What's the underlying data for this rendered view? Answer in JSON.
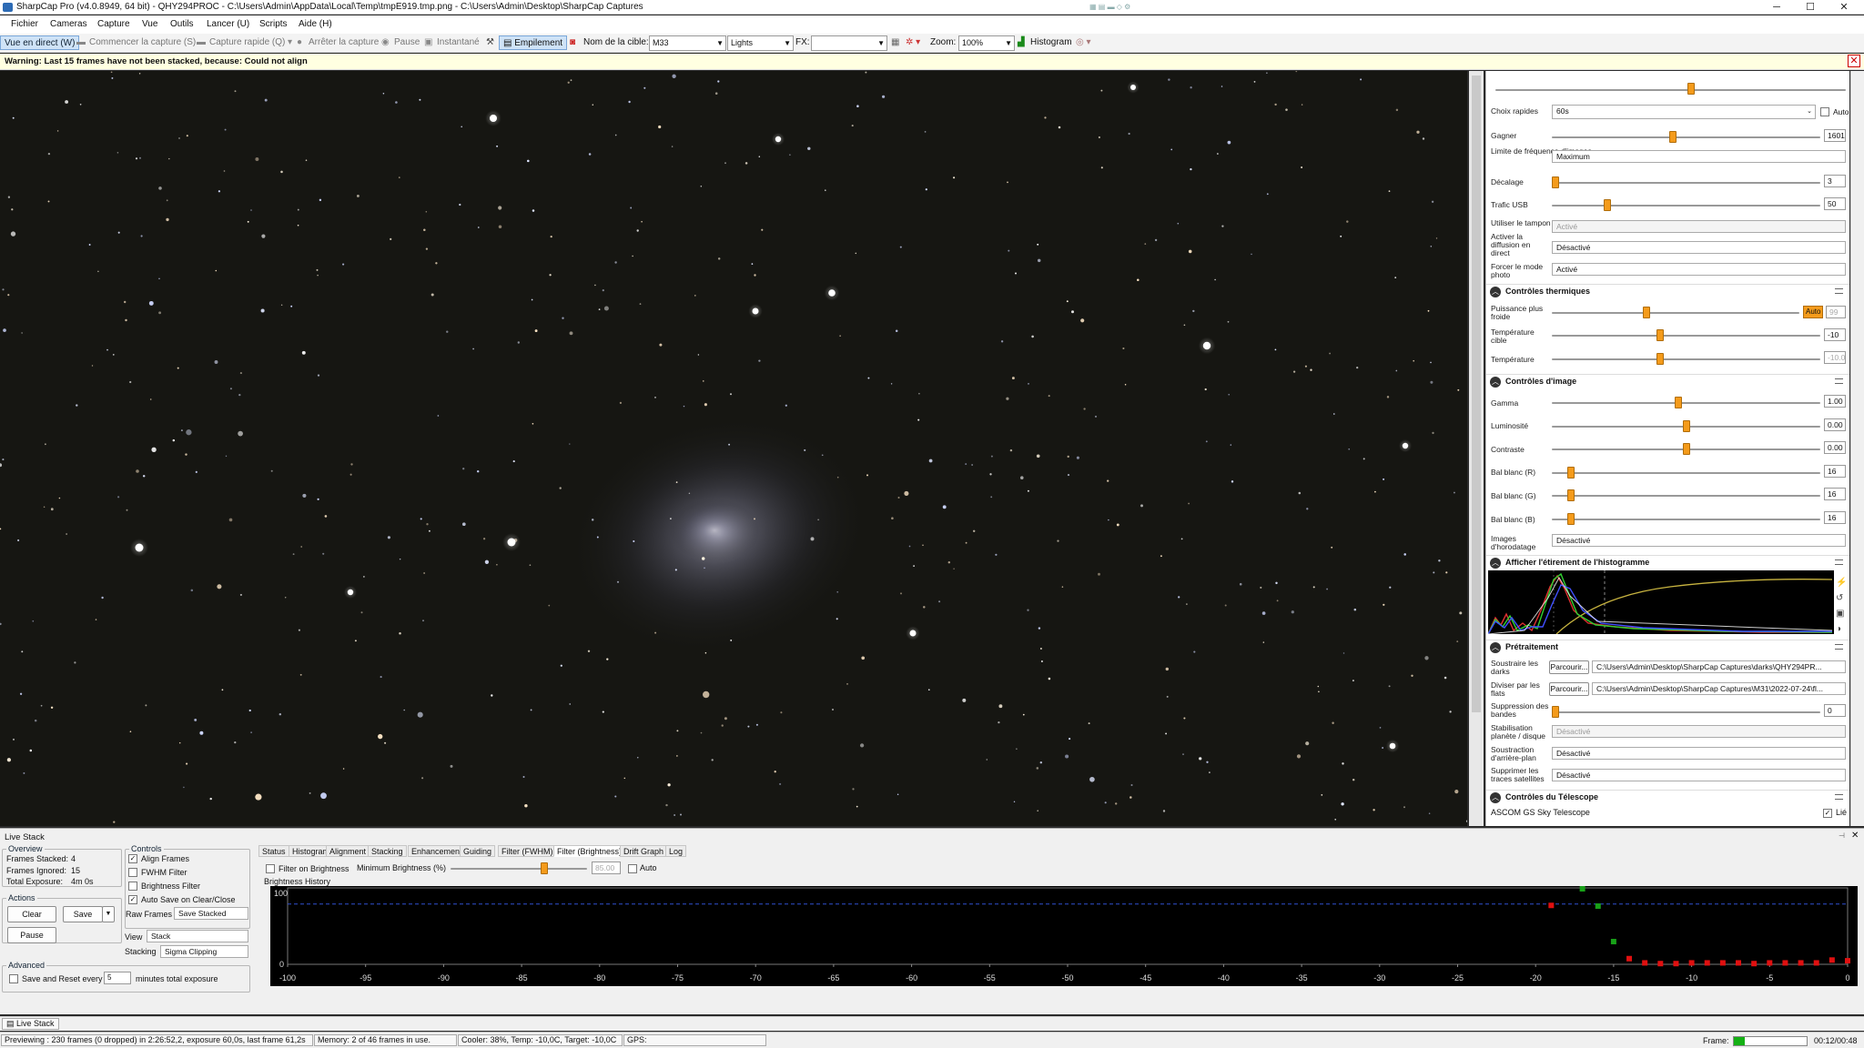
{
  "titlebar": {
    "title": "SharpCap Pro (v4.0.8949, 64 bit) - QHY294PROC - C:\\Users\\Admin\\AppData\\Local\\Temp\\tmpE919.tmp.png - C:\\Users\\Admin\\Desktop\\SharpCap Captures",
    "minimize": "─",
    "maximize": "☐",
    "close": "✕"
  },
  "menubar": [
    "Fichier",
    "Cameras",
    "Capture",
    "Vue",
    "Outils",
    "Lancer (U)",
    "Scripts",
    "Aide (H)"
  ],
  "toolbar": {
    "live_view": "Vue en direct (W)",
    "start_capture": "Commencer la capture (S)",
    "quick_capture": "Capture rapide (Q)",
    "stop_capture": "Arrêter la capture",
    "pause": "Pause",
    "snapshot": "Instantané",
    "stacking": "Empilement",
    "target_label": "Nom de la cible:",
    "target_value": "M33",
    "frame_type": "Lights",
    "fx_label": "FX:",
    "fx_value": "",
    "zoom_label": "Zoom:",
    "zoom_value": "100%",
    "histogram": "Histogram"
  },
  "warning": {
    "text": "Warning: Last 15 frames have not been stacked, because: Could not align",
    "close": "✕"
  },
  "camera_controls": {
    "quick_picks_label": "Choix rapides",
    "quick_picks_value": "60s",
    "auto_label": "Auto",
    "gain_label": "Gagner",
    "gain_value": "1601",
    "gain_level": 0.45,
    "framerate_label": "Limite de fréquence d'images",
    "framerate_value": "Maximum",
    "offset_label": "Décalage",
    "offset_value": "3",
    "offset_level": 0.0,
    "usb_label": "Trafic USB",
    "usb_value": "50",
    "usb_level": 0.2,
    "ddr_label": "Utiliser le tampon DDR",
    "ddr_value": "Activé",
    "stream_label": "Activer la diffusion en direct",
    "stream_value": "Désactivé",
    "photo_label": "Forcer le mode photo",
    "photo_value": "Activé",
    "top_slider_level": 0.56
  },
  "thermal": {
    "title": "Contrôles thermiques",
    "cooler_label": "Puissance plus froide",
    "cooler_auto": "Auto",
    "cooler_value": "99",
    "cooler_level": 0.38,
    "target_label": "Température cible",
    "target_value": "-10",
    "target_level": 0.4,
    "temp_label": "Température",
    "temp_value": "-10.0",
    "temp_level": 0.4
  },
  "image": {
    "title": "Contrôles d'image",
    "gamma_label": "Gamma",
    "gamma_value": "1.00",
    "gamma_level": 0.47,
    "brightness_label": "Luminosité",
    "brightness_value": "0.00",
    "brightness_level": 0.5,
    "contrast_label": "Contraste",
    "contrast_value": "0.00",
    "contrast_level": 0.5,
    "wbr_label": "Bal blanc (R)",
    "wbr_value": "16",
    "wbr_level": 0.06,
    "wbg_label": "Bal blanc (G)",
    "wbg_value": "16",
    "wbg_level": 0.06,
    "wbb_label": "Bal blanc (B)",
    "wbb_value": "16",
    "wbb_level": 0.06,
    "timestamp_label": "Images d'horodatage",
    "timestamp_value": "Désactivé"
  },
  "histogram_stretch": {
    "title": "Afficher l'étirement de l'histogramme"
  },
  "preprocessing": {
    "title": "Prétraitement",
    "darks_label": "Soustraire les darks",
    "darks_browse": "Parcourir...",
    "darks_path": "C:\\Users\\Admin\\Desktop\\SharpCap Captures\\darks\\QHY294PR...",
    "flats_label": "Diviser par les flats",
    "flats_browse": "Parcourir...",
    "flats_path": "C:\\Users\\Admin\\Desktop\\SharpCap Captures\\M31\\2022-07-24\\fl...",
    "banding_label": "Suppression des bandes",
    "banding_value": "0",
    "banding_level": 0.0,
    "stabilize_label": "Stabilisation planète / disque",
    "stabilize_value": "Désactivé",
    "bgsub_label": "Soustraction d'arrière-plan",
    "bgsub_value": "Désactivé",
    "sat_label": "Supprimer les traces satellites",
    "sat_value": "Désactivé"
  },
  "telescope": {
    "title": "Contrôles du Télescope",
    "mount": "ASCOM GS Sky Telescope",
    "link": "Lié"
  },
  "livestack": {
    "title": "Live Stack",
    "overview": {
      "title": "Overview",
      "stacked_label": "Frames Stacked:",
      "stacked": "4",
      "ignored_label": "Frames Ignored:",
      "ignored": "15",
      "exposure_label": "Total Exposure:",
      "exposure": "4m 0s"
    },
    "actions": {
      "title": "Actions",
      "clear": "Clear",
      "save": "Save",
      "pause": "Pause"
    },
    "controls": {
      "title": "Controls",
      "align": "Align Frames",
      "fwhm": "FWHM Filter",
      "brightness": "Brightness Filter",
      "autosave": "Auto Save on Clear/Close",
      "raw_label": "Raw Frames",
      "raw_value": "Save Stacked",
      "view_label": "View",
      "view_value": "Stack",
      "stacking_label": "Stacking",
      "stacking_value": "Sigma Clipping"
    },
    "advanced": {
      "title": "Advanced",
      "save_reset": "Save and Reset every",
      "minutes": "5",
      "suffix": "minutes total exposure"
    },
    "tabs": [
      "Status",
      "Histogram",
      "Alignment",
      "Stacking",
      "Enhancement",
      "Guiding",
      "Filter (FWHM)",
      "Filter (Brightness)",
      "Drift Graph",
      "Log"
    ],
    "filter": {
      "enable": "Filter on Brightness",
      "min_label": "Minimum Brightness (%)",
      "min_value": "85.00",
      "min_level": 0.7,
      "auto": "Auto"
    },
    "history_title": "Brightness History",
    "y_max": "100",
    "y_min": "0",
    "close_dock": "✕"
  },
  "chart_data": {
    "type": "scatter",
    "title": "Brightness History",
    "xlabel": "",
    "ylabel": "",
    "xlim": [
      -100,
      0
    ],
    "ylim": [
      0,
      100
    ],
    "ticks_x": [
      "-100",
      "-95",
      "-90",
      "-85",
      "-80",
      "-75",
      "-70",
      "-65",
      "-60",
      "-55",
      "-50",
      "-45",
      "-40",
      "-35",
      "-30",
      "-25",
      "-20",
      "-15",
      "-10",
      "-5",
      "0"
    ],
    "threshold": 85,
    "series": [
      {
        "color": "#18a018",
        "values": [
          [
            -17,
            102
          ],
          [
            -16,
            82
          ],
          [
            -15,
            32
          ]
        ]
      },
      {
        "color": "#e01010",
        "values": [
          [
            -19,
            83
          ],
          [
            -14,
            8
          ],
          [
            -13,
            2
          ],
          [
            -12,
            1
          ],
          [
            -11,
            1
          ],
          [
            -10,
            2
          ],
          [
            -9,
            2
          ],
          [
            -8,
            2
          ],
          [
            -7,
            2
          ],
          [
            -6,
            1
          ],
          [
            -5,
            2
          ],
          [
            -4,
            2
          ],
          [
            -3,
            2
          ],
          [
            -2,
            2
          ],
          [
            -1,
            6
          ],
          [
            0,
            5
          ]
        ]
      }
    ]
  },
  "statusbar": {
    "taskbar_item": "Live Stack",
    "previewing": "Previewing : 230 frames (0 dropped) in 2:26:52,2, exposure 60,0s, last frame 61,2s",
    "memory": "Memory: 2 of 46 frames in use.",
    "cooler": "Cooler: 38%, Temp: -10,0C, Target: -10,0C",
    "gps": "GPS:",
    "frame_label": "Frame:",
    "elapsed": "00:12/00:48"
  }
}
